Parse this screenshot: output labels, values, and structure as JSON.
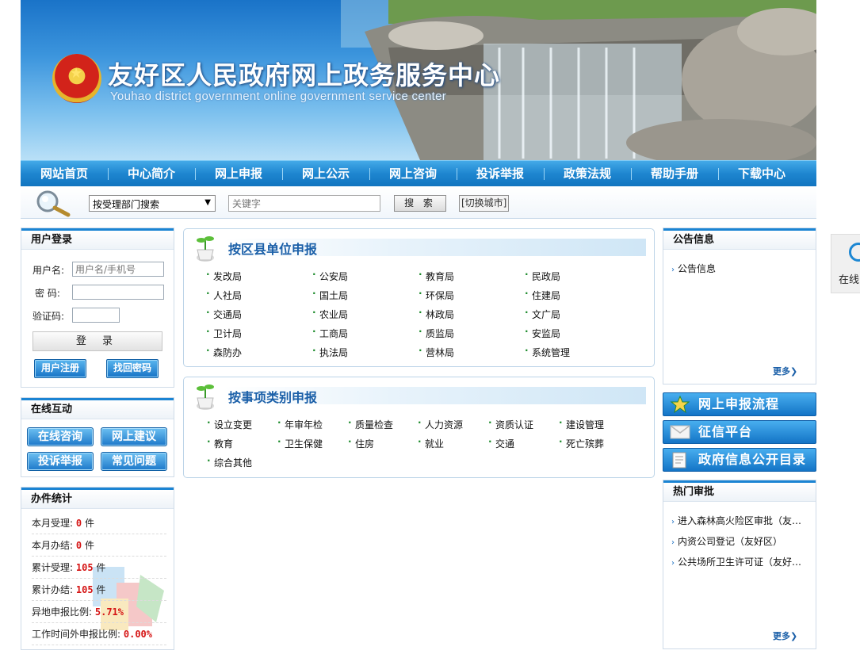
{
  "banner": {
    "title": "友好区人民政府网上政务服务中心",
    "subtitle": "Youhao district government online government service center"
  },
  "nav": [
    "网站首页",
    "中心简介",
    "网上申报",
    "网上公示",
    "网上咨询",
    "投诉举报",
    "政策法规",
    "帮助手册",
    "下载中心"
  ],
  "search": {
    "select_value": "按受理部门搜索",
    "keyword_placeholder": "关键字",
    "search_label": "搜 索",
    "switch_city": "[切换城市]"
  },
  "login": {
    "title": "用户登录",
    "username_label": "用户名:",
    "username_placeholder": "用户名/手机号",
    "password_label": "密  码:",
    "captcha_label": "验证码:",
    "login_label": "登 录",
    "register_label": "用户注册",
    "recover_label": "找回密码"
  },
  "interact": {
    "title": "在线互动",
    "buttons": [
      "在线咨询",
      "网上建议",
      "投诉举报",
      "常见问题"
    ]
  },
  "stats": {
    "title": "办件统计",
    "rows": [
      {
        "label": "本月受理:",
        "value": "0",
        "unit": "件"
      },
      {
        "label": "本月办结:",
        "value": "0",
        "unit": "件"
      },
      {
        "label": "累计受理:",
        "value": "105",
        "unit": "件"
      },
      {
        "label": "累计办结:",
        "value": "105",
        "unit": "件"
      },
      {
        "label": "异地申报比例:",
        "value": "5.71%",
        "unit": ""
      },
      {
        "label": "工作时间外申报比例:",
        "value": "0.00%",
        "unit": ""
      }
    ]
  },
  "by_unit": {
    "title": "按区县单位申报",
    "items": [
      "发改局",
      "公安局",
      "教育局",
      "民政局",
      "人社局",
      "国土局",
      "环保局",
      "住建局",
      "交通局",
      "农业局",
      "林政局",
      "文广局",
      "卫计局",
      "工商局",
      "质监局",
      "安监局",
      "森防办",
      "执法局",
      "营林局",
      "系统管理"
    ]
  },
  "by_category": {
    "title": "按事项类别申报",
    "items": [
      "设立变更",
      "年审年检",
      "质量检查",
      "人力资源",
      "资质认证",
      "建设管理",
      "教育",
      "卫生保健",
      "住房",
      "就业",
      "交通",
      "死亡殡葬",
      "综合其他"
    ]
  },
  "notice": {
    "title": "公告信息",
    "items": [
      "公告信息"
    ],
    "more": "更多"
  },
  "quick_links": [
    "网上申报流程",
    "征信平台",
    "政府信息公开目录"
  ],
  "hot": {
    "title": "热门审批",
    "items": [
      "进入森林高火险区审批（友…",
      "内资公司登记（友好区）",
      "公共场所卫生许可证（友好…"
    ],
    "more": "更多"
  },
  "float_tab": {
    "label": "在线"
  }
}
